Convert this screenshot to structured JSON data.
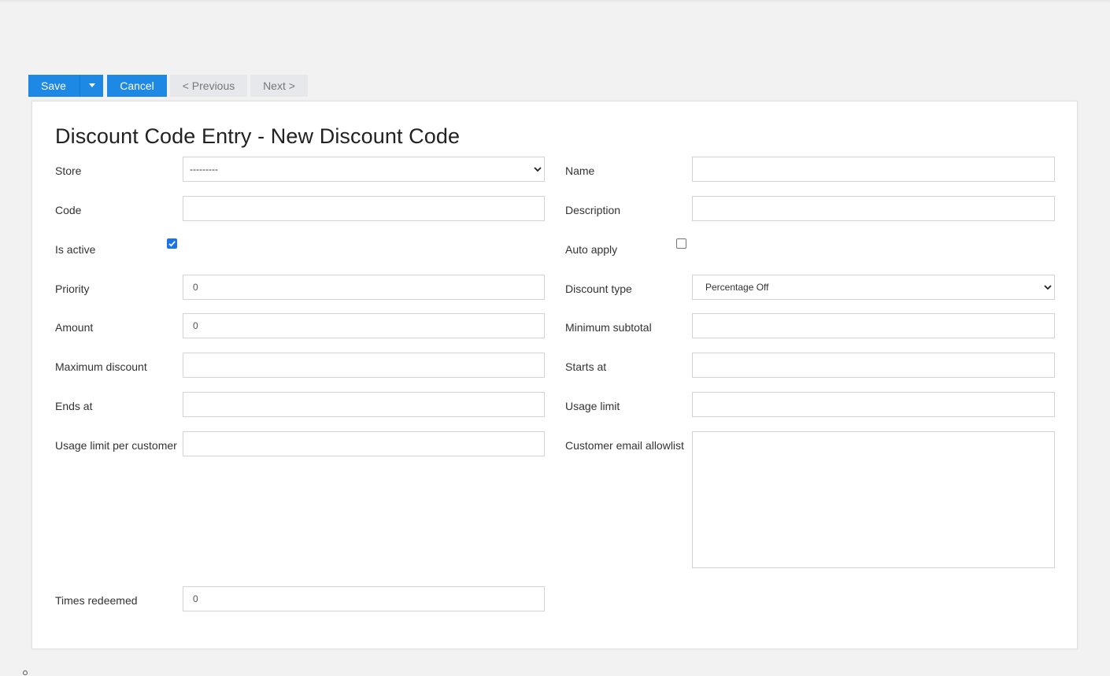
{
  "toolbar": {
    "save_label": "Save",
    "cancel_label": "Cancel",
    "previous_label": "< Previous",
    "next_label": "Next >"
  },
  "form": {
    "title": "Discount Code Entry - New Discount Code",
    "store": {
      "label": "Store",
      "value": "---------"
    },
    "name": {
      "label": "Name",
      "value": ""
    },
    "code": {
      "label": "Code",
      "value": ""
    },
    "description": {
      "label": "Description",
      "value": ""
    },
    "is_active": {
      "label": "Is active",
      "checked": true
    },
    "auto_apply": {
      "label": "Auto apply",
      "checked": false
    },
    "priority": {
      "label": "Priority",
      "value": "0"
    },
    "discount_type": {
      "label": "Discount type",
      "value": "Percentage Off"
    },
    "amount": {
      "label": "Amount",
      "value": "0"
    },
    "minimum_subtotal": {
      "label": "Minimum subtotal",
      "value": ""
    },
    "maximum_discount": {
      "label": "Maximum discount",
      "value": ""
    },
    "starts_at": {
      "label": "Starts at",
      "value": ""
    },
    "ends_at": {
      "label": "Ends at",
      "value": ""
    },
    "usage_limit": {
      "label": "Usage limit",
      "value": ""
    },
    "usage_limit_per_customer": {
      "label": "Usage limit per customer",
      "value": ""
    },
    "customer_email_allowlist": {
      "label": "Customer email allowlist",
      "value": ""
    },
    "times_redeemed": {
      "label": "Times redeemed",
      "value": "0"
    }
  },
  "colors": {
    "primary_button": "#1e88e5",
    "secondary_button": "#e6e8eb",
    "background": "#f2f2f2",
    "checkbox_accent": "#1a73e8"
  }
}
